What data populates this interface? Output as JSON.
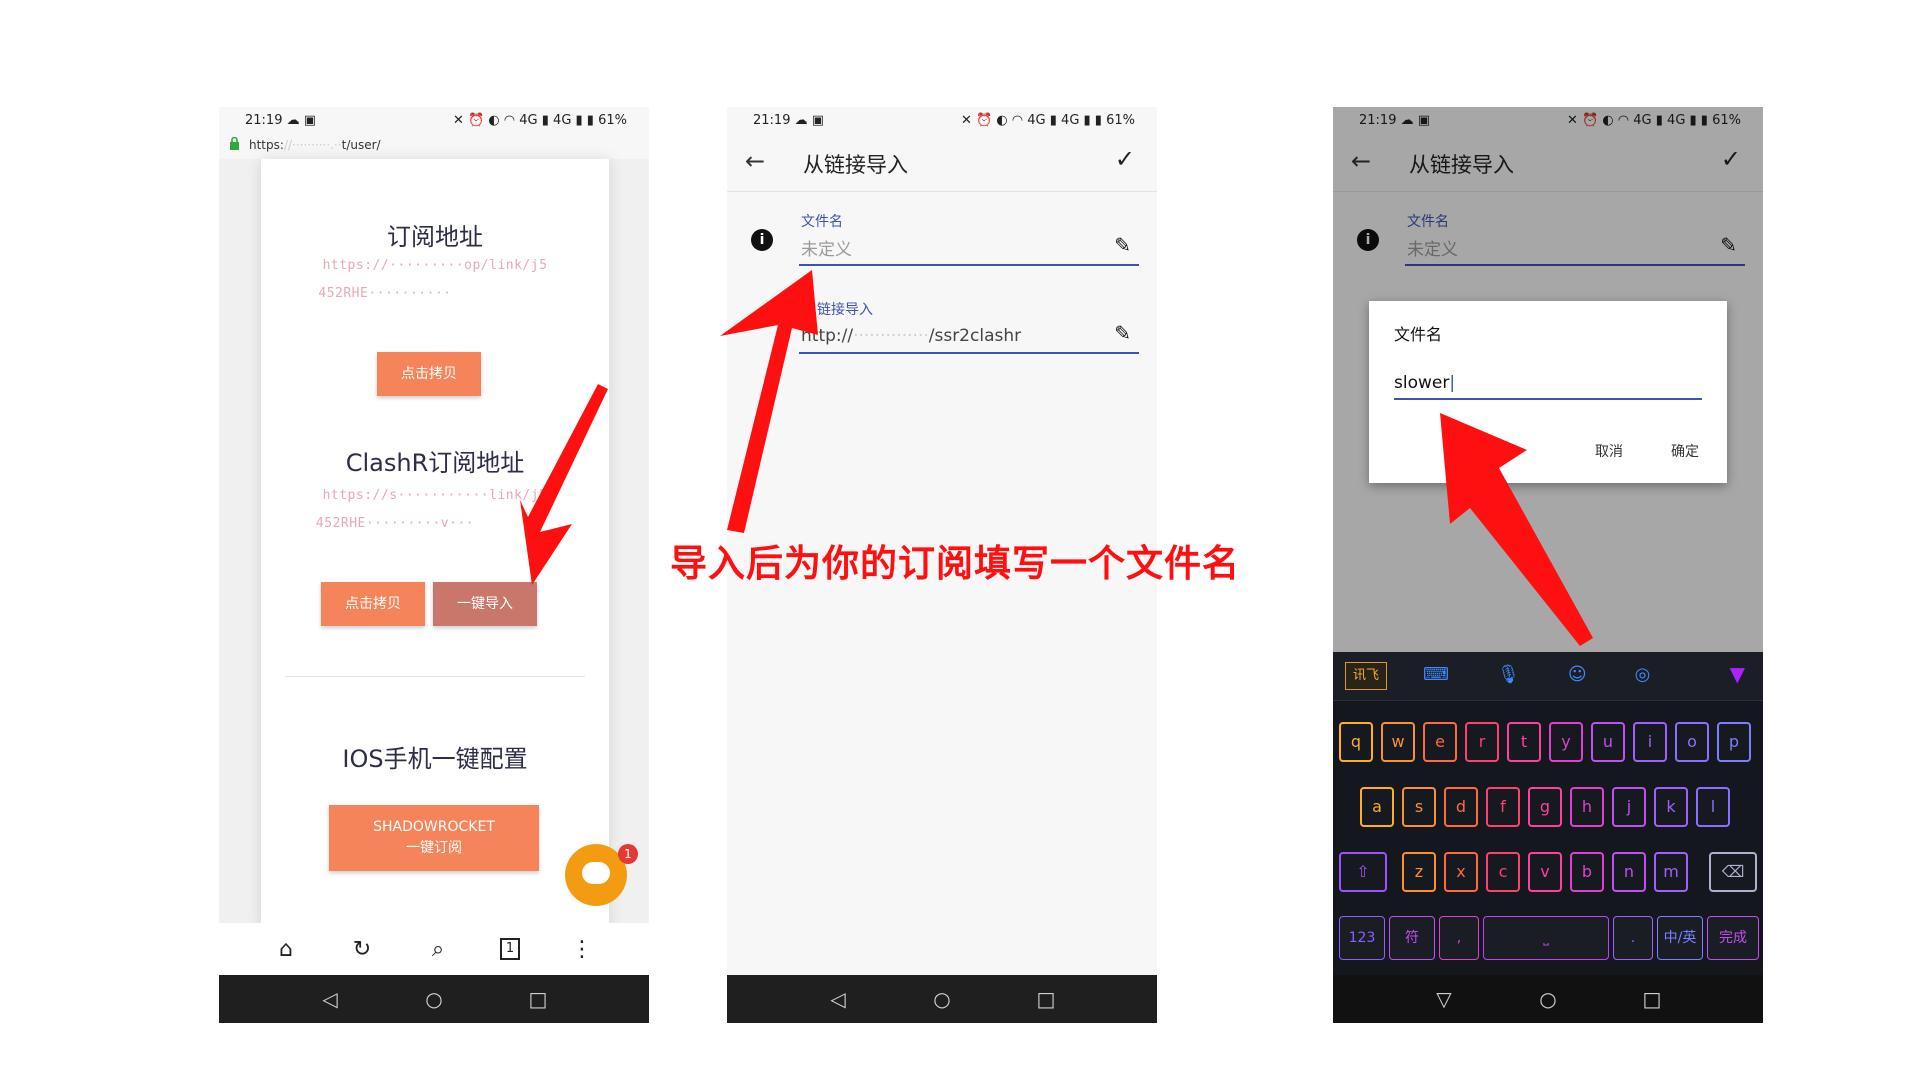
{
  "phone1": {
    "status": {
      "time": "21:19 ☁ ▣",
      "right": "✕ ⏰ ◐ ◠ 4G ▮ 4G ▮ ▮ 61%"
    },
    "url": {
      "prefix": "https:",
      "hidden": "//··········.··",
      "suffix": "t/user/"
    },
    "sections": {
      "subscribe_title": "订阅地址",
      "subscribe_url_line1": "https://·········op/link/j5",
      "subscribe_url_line2": "452RHE··········",
      "copy_button": "点击拷贝",
      "clashr_title": "ClashR订阅地址",
      "clashr_url_line1": "https://s···········link/j5",
      "clashr_url_line2": "452RHE·········v···",
      "copy_button2": "点击拷贝",
      "import_button": "一键导入",
      "ios_title": "IOS手机一键配置",
      "shadowrocket_line1": "SHADOWROCKET",
      "shadowrocket_line2": "一键订阅"
    },
    "chat_badge": "1",
    "browser_bar": {
      "home": "⌂",
      "reload": "↻",
      "search": "⌕",
      "tabs": "1",
      "menu": "⋮"
    }
  },
  "phone2": {
    "status": {
      "time": "21:19 ☁ ▣",
      "right": "✕ ⏰ ◐ ◠ 4G ▮ 4G ▮ ▮ 61%"
    },
    "appbar": {
      "title": "从链接导入"
    },
    "filename_label": "文件名",
    "filename_value": "未定义",
    "link_label": "链接导入",
    "link_value_prefix": "http://",
    "link_value_hidden": "··············",
    "link_value_suffix": "/ssr2clashr"
  },
  "phone3": {
    "status": {
      "time": "21:19 ☁ ▣",
      "right": "✕ ⏰ ◐ ◠ 4G ▮ 4G ▮ ▮ 61%"
    },
    "appbar": {
      "title": "从链接导入"
    },
    "filename_label": "文件名",
    "filename_value": "未定义",
    "dialog": {
      "title": "文件名",
      "input": "slower",
      "cancel": "取消",
      "ok": "确定"
    },
    "keyboard": {
      "brand": "讯飞",
      "row1": [
        "q",
        "w",
        "e",
        "r",
        "t",
        "y",
        "u",
        "i",
        "o",
        "p"
      ],
      "row2": [
        "a",
        "s",
        "d",
        "f",
        "g",
        "h",
        "j",
        "k",
        "l"
      ],
      "row3": [
        "z",
        "x",
        "c",
        "v",
        "b",
        "n",
        "m"
      ],
      "shift": "⇧",
      "backspace": "⌫",
      "num": "123",
      "symbol": "符",
      "comma": ",",
      "period": ".",
      "lang": "中/英",
      "done": "完成"
    }
  },
  "annotation": {
    "caption": "导入后为你的订阅填写一个文件名"
  },
  "colors": {
    "accent_orange": "#f5845a",
    "arrow_red": "#ff1010",
    "indigo": "#3f51b5"
  }
}
